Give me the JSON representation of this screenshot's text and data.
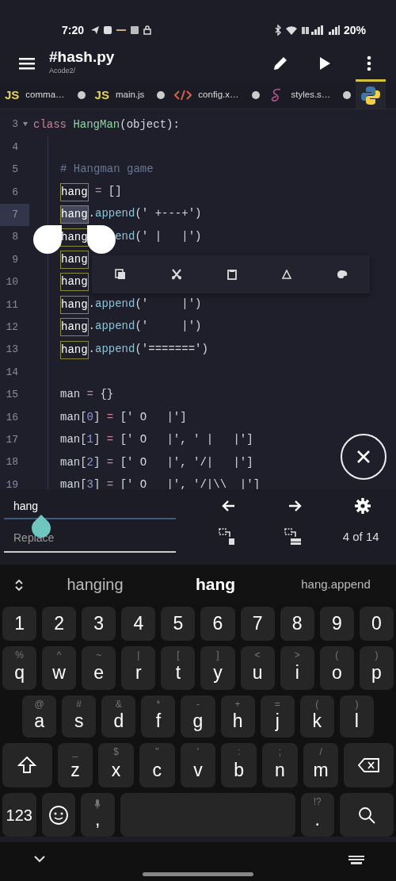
{
  "status_bar": {
    "time": "7:20",
    "battery": "20%"
  },
  "app_bar": {
    "title": "#hash.py",
    "subtitle": "Acode2/"
  },
  "tabs": [
    {
      "label": "comma…",
      "kind": "js",
      "icon_text": "JS",
      "selected": false
    },
    {
      "label": "main.js",
      "kind": "js",
      "icon_text": "JS",
      "selected": false
    },
    {
      "label": "config.x…",
      "kind": "html",
      "selected": false
    },
    {
      "label": "styles.s…",
      "kind": "sass",
      "selected": false
    },
    {
      "kind": "python",
      "selected": true
    }
  ],
  "editor": {
    "lines": [
      {
        "number": "3",
        "foldable": true,
        "current": false,
        "indented": false,
        "tokens": [
          {
            "text": "class",
            "kind": "keyword"
          },
          {
            "text": " HangMan",
            "kind": "class"
          },
          {
            "text": "(object):",
            "kind": "plain"
          }
        ]
      },
      {
        "number": "4",
        "foldable": false,
        "current": false
      },
      {
        "number": "5",
        "foldable": false,
        "current": false,
        "indented": true,
        "tokens": [
          {
            "text": "# Hangman game",
            "kind": "comment"
          }
        ]
      },
      {
        "number": "6",
        "foldable": false,
        "current": false,
        "indented": true,
        "tokens": [
          {
            "text": "hang",
            "kind": "match",
            "selected": false
          },
          {
            "text": " =",
            "kind": "operator"
          },
          {
            "text": " []",
            "kind": "plain"
          }
        ]
      },
      {
        "number": "7",
        "foldable": false,
        "current": true,
        "indented": true,
        "tokens": [
          {
            "text": "hang",
            "kind": "match",
            "selected": true
          },
          {
            "text": ".",
            "kind": "plain"
          },
          {
            "text": "append",
            "kind": "method"
          },
          {
            "text": "(' +---+')",
            "kind": "plain"
          }
        ]
      },
      {
        "number": "8",
        "foldable": false,
        "current": false,
        "indented": true,
        "tokens": [
          {
            "text": "hang",
            "kind": "match",
            "selected": false
          },
          {
            "text": "end",
            "kind": "method",
            "covered_before": true
          },
          {
            "text": "(' |   |')",
            "kind": "plain"
          }
        ]
      },
      {
        "number": "9",
        "foldable": false,
        "current": false,
        "indented": true,
        "tokens": [
          {
            "text": "hang",
            "kind": "match",
            "selected": false
          }
        ]
      },
      {
        "number": "10",
        "foldable": false,
        "current": false,
        "indented": true,
        "tokens": [
          {
            "text": "hang",
            "kind": "match",
            "selected": false
          }
        ]
      },
      {
        "number": "11",
        "foldable": false,
        "current": false,
        "indented": true,
        "tokens": [
          {
            "text": "hang",
            "kind": "match",
            "selected": false
          },
          {
            "text": ".",
            "kind": "plain"
          },
          {
            "text": "append",
            "kind": "method"
          },
          {
            "text": "('     |')",
            "kind": "plain"
          }
        ]
      },
      {
        "number": "12",
        "foldable": false,
        "current": false,
        "indented": true,
        "tokens": [
          {
            "text": "hang",
            "kind": "match",
            "selected": false
          },
          {
            "text": ".",
            "kind": "plain"
          },
          {
            "text": "append",
            "kind": "method"
          },
          {
            "text": "('     |')",
            "kind": "plain"
          }
        ]
      },
      {
        "number": "13",
        "foldable": false,
        "current": false,
        "indented": true,
        "tokens": [
          {
            "text": "hang",
            "kind": "match",
            "selected": false
          },
          {
            "text": ".",
            "kind": "plain"
          },
          {
            "text": "append",
            "kind": "method"
          },
          {
            "text": "('=======')",
            "kind": "plain"
          }
        ]
      },
      {
        "number": "14",
        "foldable": false,
        "current": false
      },
      {
        "number": "15",
        "foldable": false,
        "current": false,
        "indented": true,
        "tokens": [
          {
            "text": "man",
            "kind": "plain"
          },
          {
            "text": " =",
            "kind": "operator"
          },
          {
            "text": " {}",
            "kind": "plain"
          }
        ]
      },
      {
        "number": "16",
        "foldable": false,
        "current": false,
        "indented": true,
        "tokens": [
          {
            "text": "man[",
            "kind": "plain"
          },
          {
            "text": "0",
            "kind": "number"
          },
          {
            "text": "]",
            "kind": "plain"
          },
          {
            "text": " =",
            "kind": "operator"
          },
          {
            "text": " [' O   |']",
            "kind": "plain"
          }
        ]
      },
      {
        "number": "17",
        "foldable": false,
        "current": false,
        "indented": true,
        "tokens": [
          {
            "text": "man[",
            "kind": "plain"
          },
          {
            "text": "1",
            "kind": "number"
          },
          {
            "text": "]",
            "kind": "plain"
          },
          {
            "text": " =",
            "kind": "operator"
          },
          {
            "text": " [' O   |', ' |   |']",
            "kind": "plain"
          }
        ]
      },
      {
        "number": "18",
        "foldable": false,
        "current": false,
        "indented": true,
        "tokens": [
          {
            "text": "man[",
            "kind": "plain"
          },
          {
            "text": "2",
            "kind": "number"
          },
          {
            "text": "]",
            "kind": "plain"
          },
          {
            "text": " =",
            "kind": "operator"
          },
          {
            "text": " [' O   |', '/|   |']",
            "kind": "plain"
          }
        ]
      },
      {
        "number": "19",
        "foldable": false,
        "current": false,
        "indented": true,
        "tokens": [
          {
            "text": "man[",
            "kind": "plain"
          },
          {
            "text": "3",
            "kind": "number"
          },
          {
            "text": "]",
            "kind": "plain"
          },
          {
            "text": " =",
            "kind": "operator"
          },
          {
            "text": " [' O   |', '/|\\\\  |']",
            "kind": "plain"
          }
        ]
      }
    ]
  },
  "selection_toolbar": {
    "items": [
      {
        "kind": "copy"
      },
      {
        "kind": "cut"
      },
      {
        "kind": "paste"
      },
      {
        "kind": "triangle"
      },
      {
        "kind": "palette"
      }
    ]
  },
  "search": {
    "find_value": "hang",
    "replace_placeholder": "Replace",
    "count": "4 of 14"
  },
  "suggestions": [
    {
      "text": "hanging",
      "selected": false
    },
    {
      "text": "hang",
      "selected": true
    },
    {
      "text": "hang.append",
      "selected": false
    }
  ],
  "keyboard": {
    "rows": [
      [
        {
          "kind": "char",
          "label": "1"
        },
        {
          "kind": "char",
          "label": "2"
        },
        {
          "kind": "char",
          "label": "3"
        },
        {
          "kind": "char",
          "label": "4"
        },
        {
          "kind": "char",
          "label": "5"
        },
        {
          "kind": "char",
          "label": "6"
        },
        {
          "kind": "char",
          "label": "7"
        },
        {
          "kind": "char",
          "label": "8"
        },
        {
          "kind": "char",
          "label": "9"
        },
        {
          "kind": "char",
          "label": "0"
        }
      ],
      [
        {
          "kind": "char",
          "label": "q",
          "hint": "%"
        },
        {
          "kind": "char",
          "label": "w",
          "hint": "^"
        },
        {
          "kind": "char",
          "label": "e",
          "hint": "~"
        },
        {
          "kind": "char",
          "label": "r",
          "hint": "|"
        },
        {
          "kind": "char",
          "label": "t",
          "hint": "["
        },
        {
          "kind": "char",
          "label": "y",
          "hint": "]"
        },
        {
          "kind": "char",
          "label": "u",
          "hint": "<"
        },
        {
          "kind": "char",
          "label": "i",
          "hint": ">"
        },
        {
          "kind": "char",
          "label": "o",
          "hint": "("
        },
        {
          "kind": "char",
          "label": "p",
          "hint": ")"
        }
      ],
      [
        {
          "kind": "char",
          "label": "a",
          "hint": "@"
        },
        {
          "kind": "char",
          "label": "s",
          "hint": "#"
        },
        {
          "kind": "char",
          "label": "d",
          "hint": "&"
        },
        {
          "kind": "char",
          "label": "f",
          "hint": "*"
        },
        {
          "kind": "char",
          "label": "g",
          "hint": "-"
        },
        {
          "kind": "char",
          "label": "h",
          "hint": "+"
        },
        {
          "kind": "char",
          "label": "j",
          "hint": "="
        },
        {
          "kind": "char",
          "label": "k",
          "hint": "("
        },
        {
          "kind": "char",
          "label": "l",
          "hint": ")"
        }
      ],
      [
        {
          "kind": "shift"
        },
        {
          "kind": "char",
          "label": "z",
          "hint": "_"
        },
        {
          "kind": "char",
          "label": "x",
          "hint": "$"
        },
        {
          "kind": "char",
          "label": "c",
          "hint": "\""
        },
        {
          "kind": "char",
          "label": "v",
          "hint": "'"
        },
        {
          "kind": "char",
          "label": "b",
          "hint": ":"
        },
        {
          "kind": "char",
          "label": "n",
          "hint": ";"
        },
        {
          "kind": "char",
          "label": "m",
          "hint": "/"
        },
        {
          "kind": "backspace"
        }
      ],
      [
        {
          "kind": "text",
          "label": "123"
        },
        {
          "kind": "emoji"
        },
        {
          "kind": "mic",
          "label": ","
        },
        {
          "kind": "space"
        },
        {
          "kind": "char",
          "label": ".",
          "hint": "!?"
        },
        {
          "kind": "search"
        }
      ]
    ]
  }
}
